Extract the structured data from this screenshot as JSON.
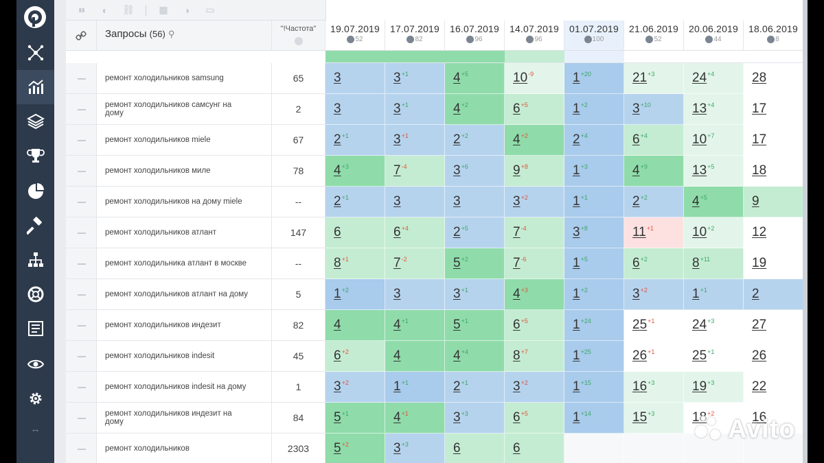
{
  "toolbar": {
    "icons": [
      "pause-icon",
      "toggle-icon",
      "link-icon",
      "grid-icon",
      "contrast-icon",
      "folder-icon"
    ]
  },
  "sidebar": {
    "items": [
      "network-icon",
      "chart-icon",
      "layers-icon",
      "trophy-icon",
      "pie-icon",
      "hammer-icon",
      "sitemap-icon",
      "lifebuoy-icon",
      "list-icon",
      "eye-icon",
      "gear-icon"
    ],
    "active": "chart-icon",
    "expand_label": "↔"
  },
  "header": {
    "query_label": "Запросы",
    "query_count": "(56)",
    "freq_label": "\"!Частота\"",
    "dates": [
      {
        "date": "19.07.2019",
        "sub": "52"
      },
      {
        "date": "17.07.2019",
        "sub": "82"
      },
      {
        "date": "16.07.2019",
        "sub": "96"
      },
      {
        "date": "14.07.2019",
        "sub": "96"
      },
      {
        "date": "01.07.2019",
        "sub": "100"
      },
      {
        "date": "21.06.2019",
        "sub": "52"
      },
      {
        "date": "20.06.2019",
        "sub": "44"
      },
      {
        "date": "18.06.2019",
        "sub": "8"
      }
    ]
  },
  "rows": [
    {
      "query": "ремонт холодильников samsung",
      "freq": "65",
      "cells": [
        [
          "3",
          "",
          "",
          "blue"
        ],
        [
          "3",
          "+1",
          "up",
          "blue"
        ],
        [
          "4",
          "+5",
          "up",
          "green"
        ],
        [
          "10",
          "-9",
          "dn",
          "vlgreen"
        ],
        [
          "1",
          "+20",
          "up",
          "blue2"
        ],
        [
          "21",
          "+3",
          "up",
          "vlgreen"
        ],
        [
          "24",
          "+4",
          "up",
          "vlgreen"
        ],
        [
          "28",
          "",
          "",
          "white"
        ]
      ]
    },
    {
      "query": "ремонт холодильников самсунг на дому",
      "freq": "2",
      "cells": [
        [
          "3",
          "",
          "",
          "blue"
        ],
        [
          "3",
          "+1",
          "up",
          "blue"
        ],
        [
          "4",
          "+2",
          "up",
          "green"
        ],
        [
          "6",
          "+5",
          "dn",
          "lgreen"
        ],
        [
          "1",
          "+2",
          "up",
          "blue2"
        ],
        [
          "3",
          "+10",
          "up",
          "blue"
        ],
        [
          "13",
          "+4",
          "up",
          "vlgreen"
        ],
        [
          "17",
          "",
          "",
          "white"
        ]
      ]
    },
    {
      "query": "ремонт холодильников miele",
      "freq": "67",
      "cells": [
        [
          "2",
          "+1",
          "up",
          "blue"
        ],
        [
          "3",
          "+1",
          "dn",
          "blue"
        ],
        [
          "2",
          "+2",
          "up",
          "blue"
        ],
        [
          "4",
          "+2",
          "dn",
          "green"
        ],
        [
          "2",
          "+4",
          "up",
          "blue2"
        ],
        [
          "6",
          "+4",
          "up",
          "lgreen"
        ],
        [
          "10",
          "+7",
          "up",
          "vlgreen"
        ],
        [
          "17",
          "",
          "",
          "white"
        ]
      ]
    },
    {
      "query": "ремонт холодильников миле",
      "freq": "78",
      "cells": [
        [
          "4",
          "+3",
          "up",
          "green"
        ],
        [
          "7",
          "-4",
          "dn",
          "lgreen"
        ],
        [
          "3",
          "+6",
          "up",
          "blue"
        ],
        [
          "9",
          "+8",
          "dn",
          "lgreen"
        ],
        [
          "1",
          "+3",
          "up",
          "blue2"
        ],
        [
          "4",
          "+9",
          "up",
          "green"
        ],
        [
          "13",
          "+5",
          "up",
          "vlgreen"
        ],
        [
          "18",
          "",
          "",
          "white"
        ]
      ]
    },
    {
      "query": "ремонт холодильников на дому miele",
      "freq": "--",
      "cells": [
        [
          "2",
          "+1",
          "up",
          "blue"
        ],
        [
          "3",
          "",
          "",
          "blue"
        ],
        [
          "3",
          "",
          "",
          "blue"
        ],
        [
          "3",
          "+2",
          "dn",
          "blue"
        ],
        [
          "1",
          "+1",
          "up",
          "blue2"
        ],
        [
          "2",
          "+2",
          "up",
          "blue"
        ],
        [
          "4",
          "+5",
          "up",
          "green"
        ],
        [
          "9",
          "",
          "",
          "lgreen"
        ]
      ]
    },
    {
      "query": "ремонт холодильников атлант",
      "freq": "147",
      "cells": [
        [
          "6",
          "",
          "",
          "lgreen"
        ],
        [
          "6",
          "+4",
          "dn",
          "lgreen"
        ],
        [
          "2",
          "+5",
          "up",
          "blue"
        ],
        [
          "7",
          "-4",
          "dn",
          "lgreen"
        ],
        [
          "3",
          "+8",
          "up",
          "blue2"
        ],
        [
          "11",
          "+1",
          "dn",
          "pink"
        ],
        [
          "10",
          "+2",
          "up",
          "vlgreen"
        ],
        [
          "12",
          "",
          "",
          "white"
        ]
      ]
    },
    {
      "query": "ремонт холодильника атлант в москве",
      "freq": "--",
      "cells": [
        [
          "8",
          "+1",
          "dn",
          "lgreen"
        ],
        [
          "7",
          "-2",
          "dn",
          "lgreen"
        ],
        [
          "5",
          "+2",
          "up",
          "green"
        ],
        [
          "7",
          "-6",
          "dn",
          "lgreen"
        ],
        [
          "1",
          "+5",
          "up",
          "blue2"
        ],
        [
          "6",
          "+2",
          "up",
          "lgreen"
        ],
        [
          "8",
          "+11",
          "up",
          "lgreen"
        ],
        [
          "19",
          "",
          "",
          "white"
        ]
      ]
    },
    {
      "query": "ремонт холодильников атлант на дому",
      "freq": "5",
      "cells": [
        [
          "1",
          "+2",
          "up",
          "blue2"
        ],
        [
          "3",
          "",
          "",
          "blue"
        ],
        [
          "3",
          "+1",
          "up",
          "blue"
        ],
        [
          "4",
          "+3",
          "dn",
          "green"
        ],
        [
          "1",
          "+2",
          "up",
          "blue2"
        ],
        [
          "3",
          "+2",
          "dn",
          "blue"
        ],
        [
          "1",
          "+1",
          "up",
          "blue"
        ],
        [
          "2",
          "",
          "",
          "blue"
        ]
      ]
    },
    {
      "query": "ремонт холодильников индезит",
      "freq": "82",
      "cells": [
        [
          "4",
          "",
          "",
          "green"
        ],
        [
          "4",
          "+1",
          "up",
          "green"
        ],
        [
          "5",
          "+1",
          "up",
          "green"
        ],
        [
          "6",
          "+5",
          "dn",
          "lgreen"
        ],
        [
          "1",
          "+24",
          "up",
          "blue2"
        ],
        [
          "25",
          "+1",
          "dn",
          "white"
        ],
        [
          "24",
          "+3",
          "up",
          "white"
        ],
        [
          "27",
          "",
          "",
          "white"
        ]
      ]
    },
    {
      "query": "ремонт холодильников indesit",
      "freq": "45",
      "cells": [
        [
          "6",
          "+2",
          "dn",
          "lgreen"
        ],
        [
          "4",
          "",
          "",
          "green"
        ],
        [
          "4",
          "+4",
          "up",
          "green"
        ],
        [
          "8",
          "+7",
          "dn",
          "lgreen"
        ],
        [
          "1",
          "+25",
          "up",
          "blue2"
        ],
        [
          "26",
          "+1",
          "dn",
          "white"
        ],
        [
          "25",
          "+1",
          "up",
          "white"
        ],
        [
          "26",
          "",
          "",
          "white"
        ]
      ]
    },
    {
      "query": "ремонт холодильников indesit на дому",
      "freq": "1",
      "cells": [
        [
          "3",
          "+2",
          "dn",
          "blue"
        ],
        [
          "1",
          "+1",
          "up",
          "blue2"
        ],
        [
          "2",
          "+1",
          "up",
          "blue"
        ],
        [
          "3",
          "+2",
          "dn",
          "blue"
        ],
        [
          "1",
          "+15",
          "up",
          "blue2"
        ],
        [
          "16",
          "+3",
          "up",
          "vlgreen"
        ],
        [
          "19",
          "+3",
          "up",
          "vlgreen"
        ],
        [
          "22",
          "",
          "",
          "white"
        ]
      ]
    },
    {
      "query": "ремонт холодильников индезит на дому",
      "freq": "84",
      "cells": [
        [
          "5",
          "+1",
          "up",
          "green"
        ],
        [
          "4",
          "+1",
          "dn",
          "green"
        ],
        [
          "3",
          "+3",
          "up",
          "blue"
        ],
        [
          "6",
          "+5",
          "dn",
          "lgreen"
        ],
        [
          "1",
          "+14",
          "up",
          "blue2"
        ],
        [
          "15",
          "+3",
          "up",
          "vlgreen"
        ],
        [
          "18",
          "+2",
          "dn",
          "white"
        ],
        [
          "16",
          "",
          "",
          "white"
        ]
      ]
    },
    {
      "query": "ремонт холодильников",
      "freq": "2303",
      "cells": [
        [
          "5",
          "+2",
          "dn",
          "green"
        ],
        [
          "3",
          "+3",
          "up",
          "blue"
        ],
        [
          "6",
          "",
          "",
          "lgreen"
        ],
        [
          "6",
          "",
          "",
          "lgreen"
        ],
        [
          "",
          "",
          "",
          "empty"
        ],
        [
          "",
          "",
          "",
          "empty"
        ],
        [
          "",
          "",
          "",
          "empty"
        ],
        [
          "",
          "",
          "",
          "empty"
        ]
      ]
    }
  ],
  "watermark": "Avito"
}
